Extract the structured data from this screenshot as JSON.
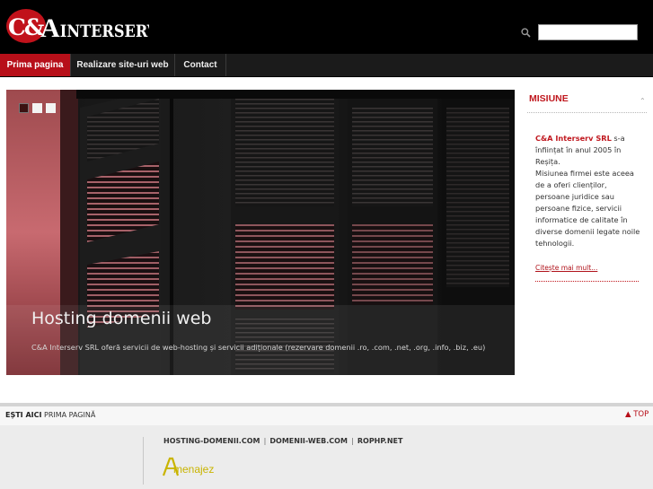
{
  "header": {
    "logo_text": "C&A INTERSERV",
    "search": {
      "placeholder": "",
      "value": ""
    }
  },
  "nav": {
    "items": [
      {
        "label": "Prima pagina",
        "active": true
      },
      {
        "label": "Realizare site-uri web",
        "active": false
      },
      {
        "label": "Contact",
        "active": false
      }
    ]
  },
  "slider": {
    "dots": 3,
    "active_dot": 1,
    "title": "Hosting domenii web",
    "text": "C&A Interserv SRL oferă servicii de web-hosting și servicii adiționale (rezervare domenii .ro, .com, .net, .org, .info, .biz, .eu)"
  },
  "sidebar": {
    "title": "MISIUNE",
    "arrow": "⌃",
    "brand": "C&A Interserv SRL",
    "intro_rest": " s-a înființat în anul 2005 în Reșița.",
    "mission": "Misiunea firmei este aceea de a oferi clienților, persoane juridice sau persoane fizice, servicii informatice de calitate în diverse domenii legate noile tehnologii.",
    "read_more": "Citește mai mult..."
  },
  "breadcrumb": {
    "label": "EȘTI AICI",
    "current": "PRIMA PAGINĂ",
    "top_link": "▲ TOP"
  },
  "footer": {
    "links": [
      "HOSTING-DOMENII.COM",
      "DOMENII-WEB.COM",
      "ROPHP.NET"
    ],
    "separator": "|",
    "partner_logo_text": "Amenajez"
  },
  "colors": {
    "brand_red": "#b70f19",
    "accent_yellow": "#c9b400"
  }
}
